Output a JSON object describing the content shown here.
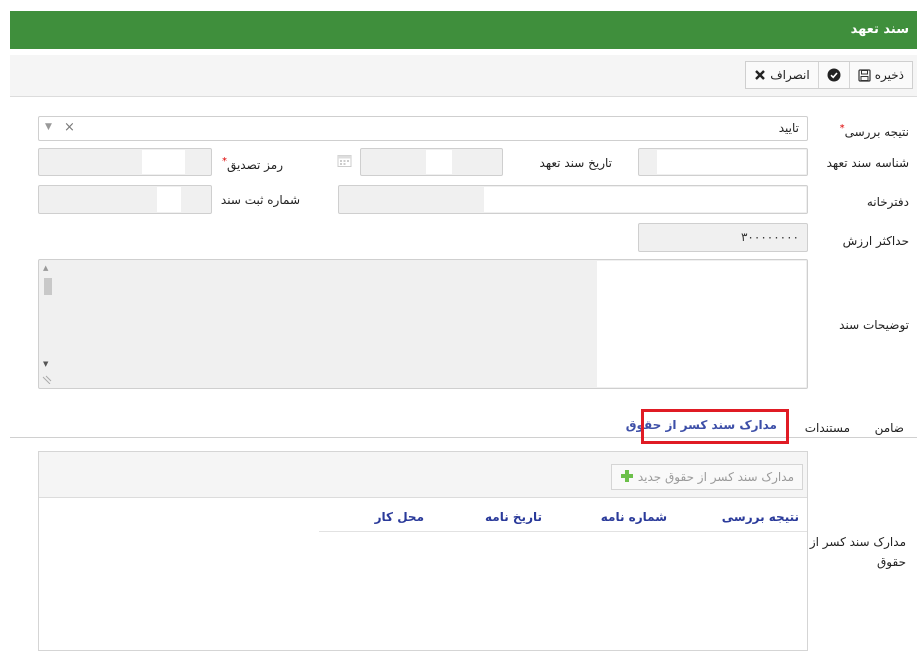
{
  "window": {
    "title": "سند تعهد"
  },
  "toolbar": {
    "save_label": "ذخیره",
    "cancel_label": "انصراف"
  },
  "form": {
    "review_result": {
      "label": "نتیجه بررسی",
      "value": "تایید"
    },
    "commitment_id": {
      "label": "شناسه سند تعهد",
      "value": ""
    },
    "commitment_date": {
      "label": "تاریخ سند تعهد",
      "value": ""
    },
    "verification_code": {
      "label": "رمز تصدیق",
      "value": ""
    },
    "notary": {
      "label": "دفترخانه",
      "value": ""
    },
    "registration_number": {
      "label": "شماره ثبت سند",
      "value": ""
    },
    "max_value": {
      "label": "حداکثر ارزش",
      "value": "۳۰۰۰۰۰۰۰۰"
    },
    "description": {
      "label": "توضیحات سند",
      "value": ""
    }
  },
  "tabs": [
    {
      "label": "ضامن",
      "active": false
    },
    {
      "label": "مستندات",
      "active": false
    },
    {
      "label": "مدارک سند کسر از حقوق",
      "active": true
    }
  ],
  "grid": {
    "section_label": "مدارک سند کسر از حقوق",
    "add_label": "مدارک سند کسر از حقوق جدید",
    "columns": [
      "نتیجه بررسی",
      "شماره نامه",
      "تاریخ نامه",
      "محل کار"
    ]
  },
  "colors": {
    "header": "#3f8f3c",
    "accent": "#3d4fa8",
    "highlight": "#e01b24",
    "add_icon": "#6cc04a"
  }
}
